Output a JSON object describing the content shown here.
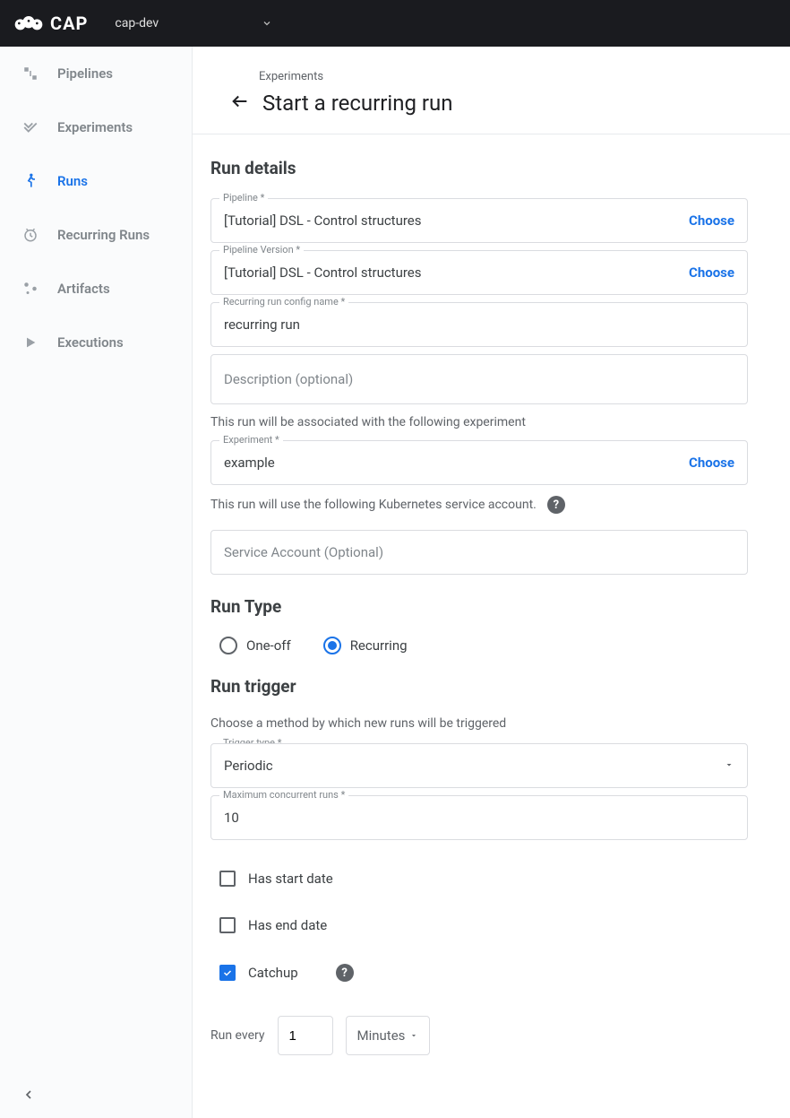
{
  "brand": "CAP",
  "namespace": "cap-dev",
  "sidebar": {
    "items": [
      {
        "label": "Pipelines"
      },
      {
        "label": "Experiments"
      },
      {
        "label": "Runs"
      },
      {
        "label": "Recurring Runs"
      },
      {
        "label": "Artifacts"
      },
      {
        "label": "Executions"
      }
    ]
  },
  "breadcrumb": "Experiments",
  "page_title": "Start a recurring run",
  "sections": {
    "details_heading": "Run details",
    "runtype_heading": "Run Type",
    "trigger_heading": "Run trigger"
  },
  "fields": {
    "pipeline": {
      "label": "Pipeline *",
      "value": "[Tutorial] DSL - Control structures",
      "action": "Choose"
    },
    "pipeline_version": {
      "label": "Pipeline Version *",
      "value": "[Tutorial] DSL - Control structures",
      "action": "Choose"
    },
    "config_name": {
      "label": "Recurring run config name *",
      "value": "recurring run"
    },
    "description": {
      "placeholder": "Description (optional)"
    },
    "experiment_helper": "This run will be associated with the following experiment",
    "experiment": {
      "label": "Experiment *",
      "value": "example",
      "action": "Choose"
    },
    "sa_helper": "This run will use the following Kubernetes service account.",
    "service_account": {
      "placeholder": "Service Account (Optional)"
    },
    "trigger_helper": "Choose a method by which new runs will be triggered",
    "trigger_type": {
      "label": "Trigger type *",
      "value": "Periodic"
    },
    "max_concurrent": {
      "label": "Maximum concurrent runs *",
      "value": "10"
    },
    "has_start": "Has start date",
    "has_end": "Has end date",
    "catchup": "Catchup",
    "interval_label": "Run every",
    "interval_value": "1",
    "interval_unit": "Minutes"
  },
  "runtype": {
    "oneoff": "One-off",
    "recurring": "Recurring"
  }
}
